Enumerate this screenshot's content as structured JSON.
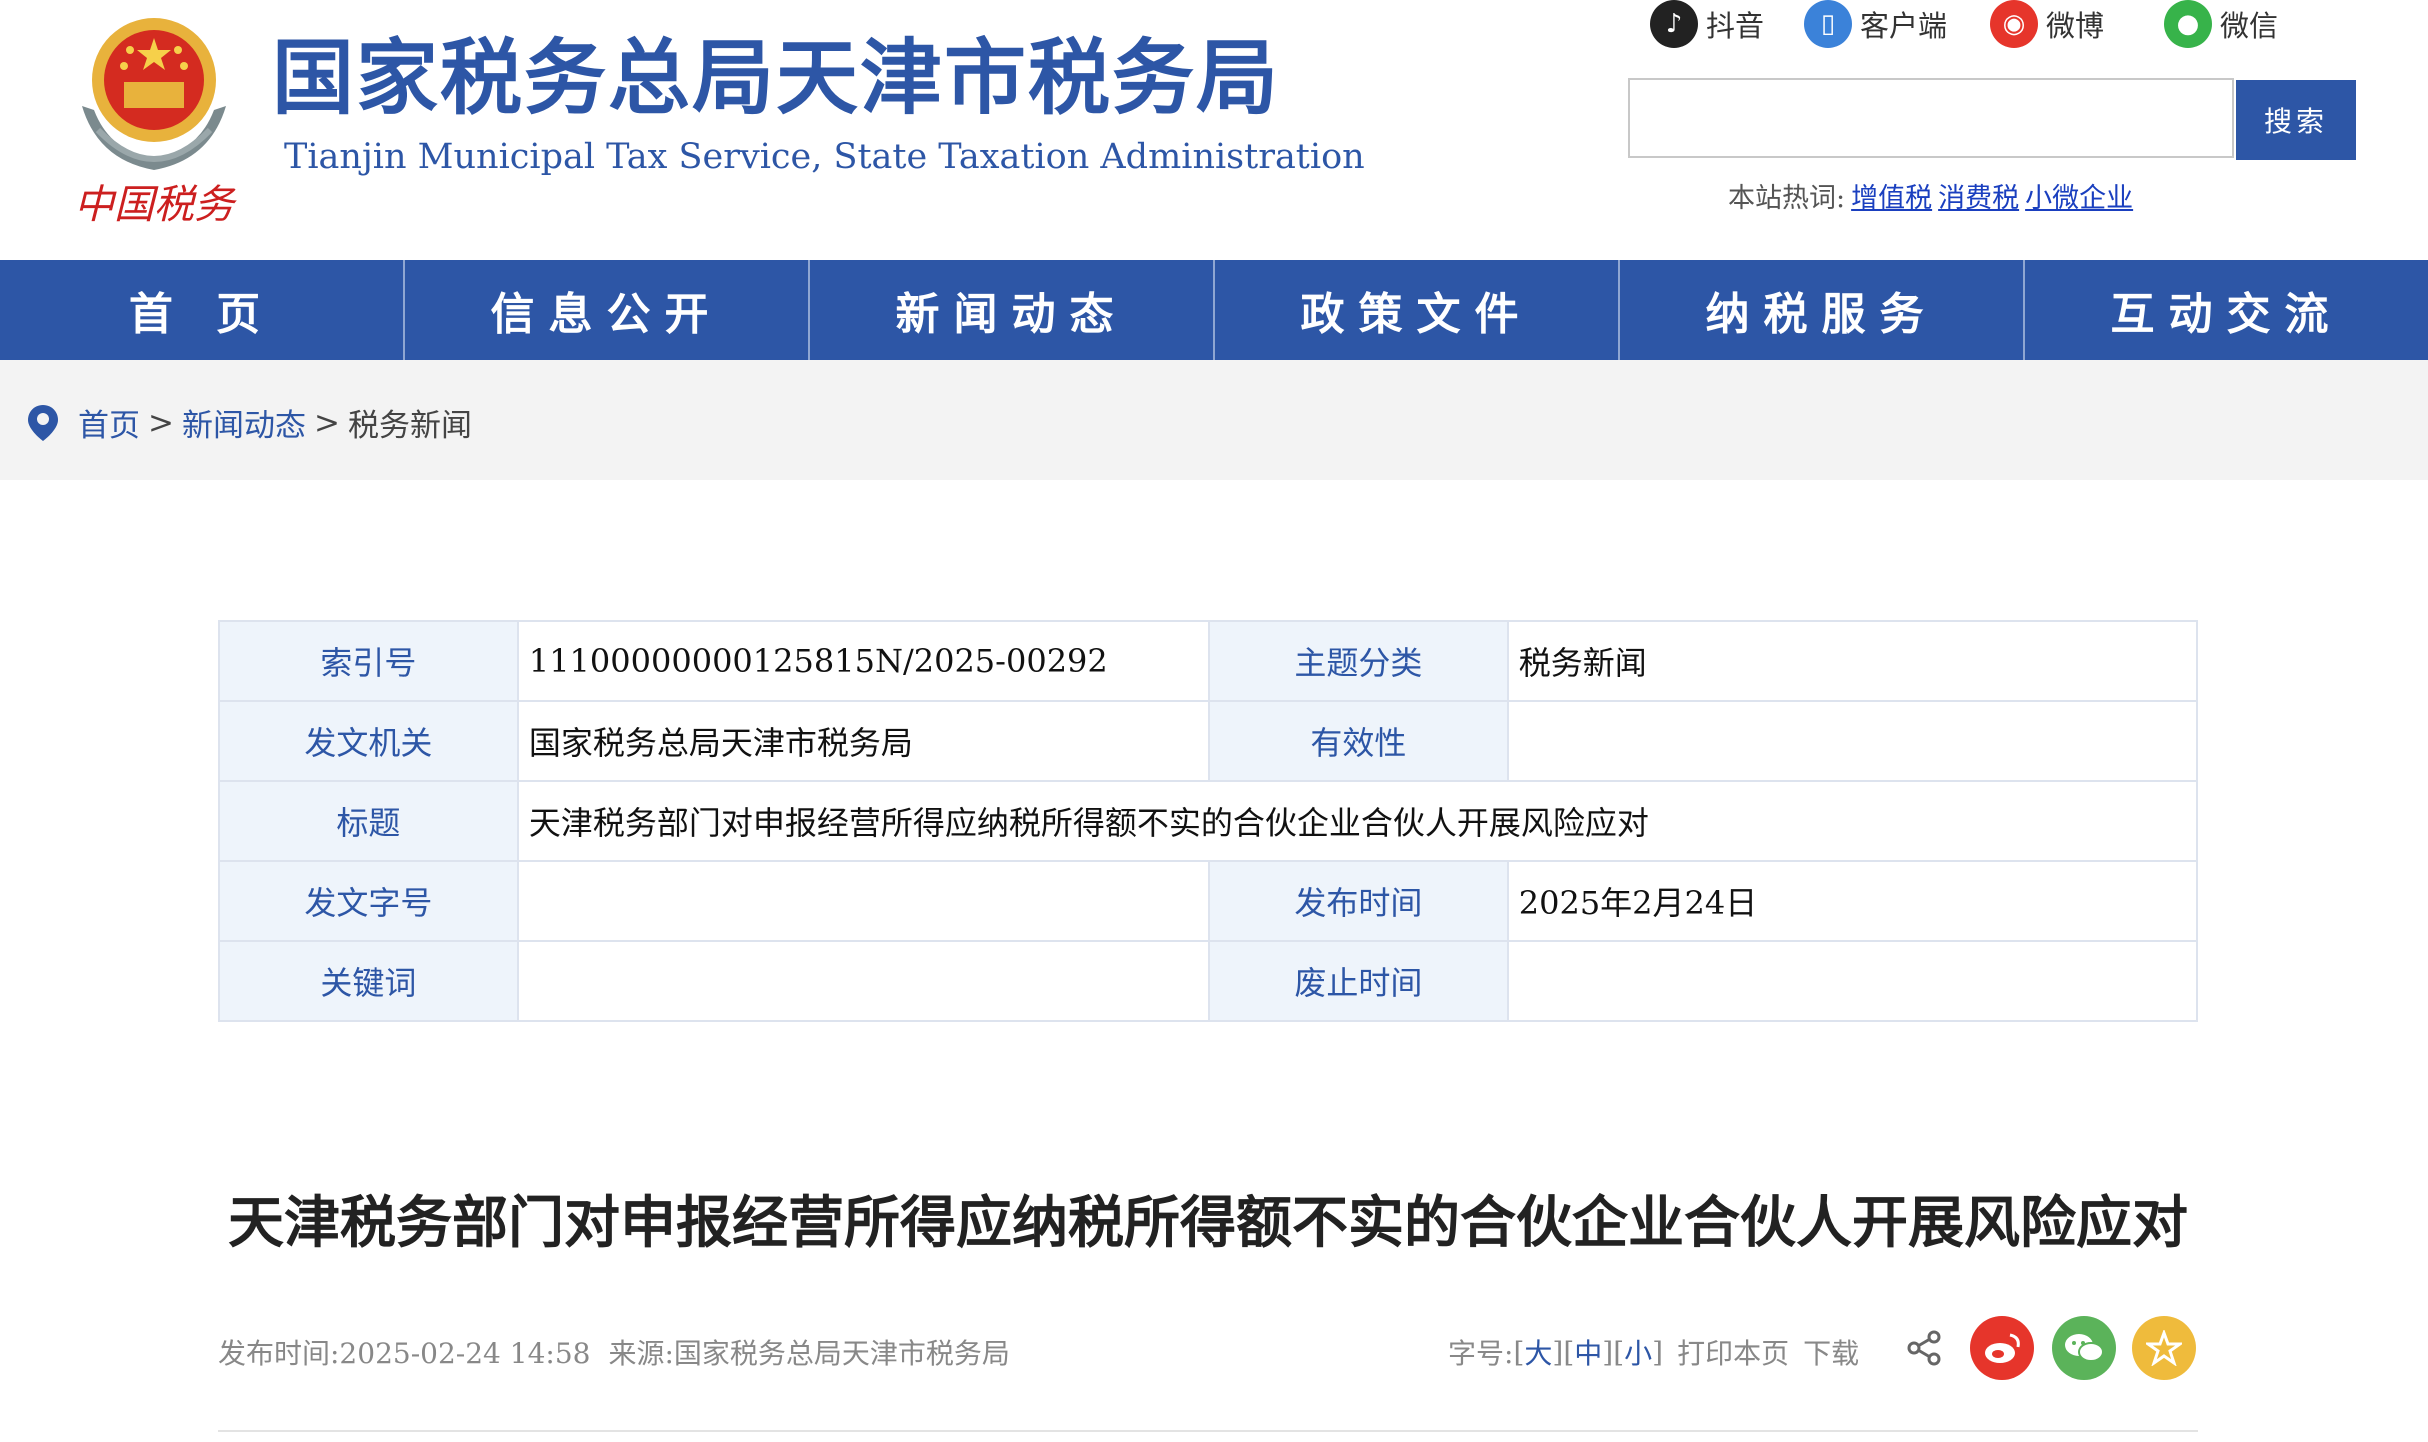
{
  "header": {
    "title_cn": "国家税务总局天津市税务局",
    "title_en": "Tianjin Municipal Tax Service, State Taxation Administration",
    "social": [
      {
        "icon": "douyin-icon",
        "label": "抖音",
        "color": "#222222"
      },
      {
        "icon": "mobile-client-icon",
        "label": "客户端",
        "color": "#3b82d9"
      },
      {
        "icon": "weibo-icon",
        "label": "微博",
        "color": "#e6352b"
      },
      {
        "icon": "wechat-icon",
        "label": "微信",
        "color": "#37b34a"
      }
    ],
    "search": {
      "placeholder": "",
      "button": "搜索"
    },
    "hotwords": {
      "label": "本站热词:",
      "items": [
        "增值税",
        "消费税",
        "小微企业"
      ]
    }
  },
  "nav": [
    "首 页",
    "信息公开",
    "新闻动态",
    "政策文件",
    "纳税服务",
    "互动交流"
  ],
  "breadcrumb": {
    "items": [
      "首页",
      "新闻动态"
    ],
    "separator": ">",
    "current": "税务新闻"
  },
  "info_table": {
    "index_label": "索引号",
    "index_value": "11100000000125815N/2025-00292",
    "topic_label": "主题分类",
    "topic_value": "税务新闻",
    "issuer_label": "发文机关",
    "issuer_value": "国家税务总局天津市税务局",
    "validity_label": "有效性",
    "validity_value": "",
    "title_label": "标题",
    "title_value": "天津税务部门对申报经营所得应纳税所得额不实的合伙企业合伙人开展风险应对",
    "docno_label": "发文字号",
    "docno_value": "",
    "pubdate_label": "发布时间",
    "pubdate_value": "2025年2月24日",
    "keywords_label": "关键词",
    "keywords_value": "",
    "expire_label": "废止时间",
    "expire_value": ""
  },
  "article": {
    "title": "天津税务部门对申报经营所得应纳税所得额不实的合伙企业合伙人开展风险应对",
    "publish": "发布时间:2025-02-24 14:58",
    "source": "来源:国家税务总局天津市税务局",
    "font_label": "字号:",
    "size_large": "大",
    "size_medium": "中",
    "size_small": "小",
    "print": "打印本页",
    "download": "下载"
  },
  "share_colors": {
    "weibo": "#e6352b",
    "wechat": "#5bb35a",
    "favorite": "#efbb3c"
  }
}
